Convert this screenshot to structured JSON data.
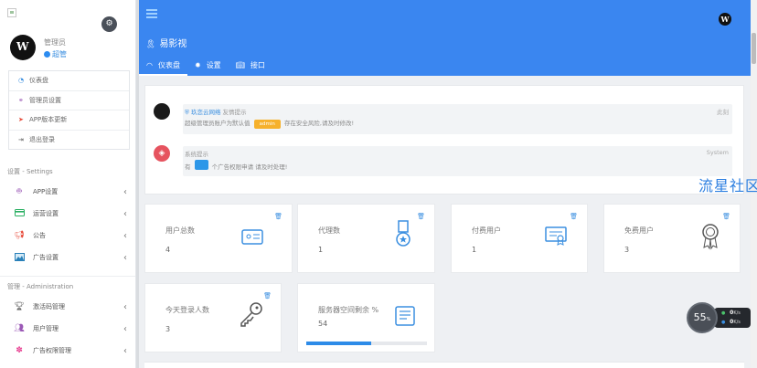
{
  "sidebar": {
    "user": {
      "name": "管理员",
      "role": "超管",
      "avatar_letter": "W"
    },
    "quick_links": [
      {
        "label": "仪表盘",
        "icon": "dashboard-icon",
        "color": "#3b8fe0"
      },
      {
        "label": "管理员设置",
        "icon": "users-cog-icon",
        "color": "#9b59b6"
      },
      {
        "label": "APP版本更新",
        "icon": "paper-plane-icon",
        "color": "#e74c3c"
      },
      {
        "label": "退出登录",
        "icon": "logout-icon",
        "color": "#555555"
      }
    ],
    "settings_section": {
      "title": "设置 - Settings",
      "items": [
        {
          "label": "APP设置",
          "icon": "android-icon",
          "color": "#9b59b6"
        },
        {
          "label": "运营设置",
          "icon": "credit-card-icon",
          "color": "#27ae60"
        },
        {
          "label": "公告",
          "icon": "bullhorn-icon",
          "color": "#e74c3c"
        },
        {
          "label": "广告设置",
          "icon": "image-icon",
          "color": "#2980b9"
        }
      ]
    },
    "admin_section": {
      "title": "管理 - Administration",
      "items": [
        {
          "label": "激活码管理",
          "icon": "trophy-icon",
          "color": "#555555"
        },
        {
          "label": "用户管理",
          "icon": "users-icon",
          "color": "#9b59b6"
        },
        {
          "label": "广告权限管理",
          "icon": "asterisk-icon",
          "color": "#e84393"
        }
      ]
    }
  },
  "header": {
    "app_title": "易影视",
    "tabs": [
      {
        "label": "仪表盘",
        "icon": "dashboard-icon",
        "active": true
      },
      {
        "label": "设置",
        "icon": "gear-icon",
        "active": false
      },
      {
        "label": "接口",
        "icon": "book-icon",
        "active": false
      }
    ],
    "avatar_letter": "W"
  },
  "notices": [
    {
      "source_link": "玖恋云网络",
      "title_suffix": "友情提示",
      "time": "此刻",
      "body_before": "超级管理员账户为默认值",
      "badge": "admin",
      "body_after": "存在安全风险,请及时修改!"
    },
    {
      "title": "系统提示",
      "time": "System",
      "body_before": "有",
      "badge": "",
      "body_after": "个广告权限申请 请及时处理!"
    }
  ],
  "watermark": "流星社区",
  "stats": [
    {
      "label": "用户总数",
      "value": "4",
      "icon": "id-card-icon"
    },
    {
      "label": "代理数",
      "value": "1",
      "icon": "medal-icon"
    },
    {
      "label": "付费用户",
      "value": "1",
      "icon": "certificate-icon"
    },
    {
      "label": "免费用户",
      "value": "3",
      "icon": "award-icon"
    },
    {
      "label": "今天登录人数",
      "value": "3",
      "icon": "key-icon"
    },
    {
      "label": "服务器空间剩余 %",
      "value": "54",
      "icon": "server-list-icon",
      "progress_percent": 54
    }
  ],
  "net_widget": {
    "percent": "55",
    "percent_unit": "%",
    "upload": "0",
    "upload_unit": "K/s",
    "download": "0",
    "download_unit": "K/s"
  },
  "colors": {
    "header_blue": "#3a86f0",
    "accent_blue": "#3b8fe0",
    "badge_orange": "#f6b12c",
    "notice_red": "#e6535f"
  }
}
